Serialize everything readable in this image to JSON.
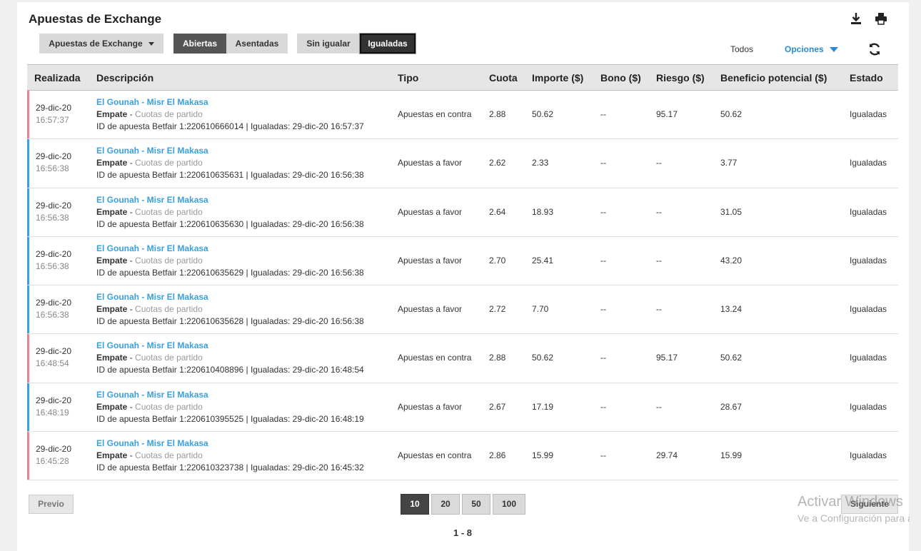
{
  "header": {
    "title": "Apuestas de Exchange",
    "download_icon": "download-icon",
    "print_icon": "print-icon"
  },
  "toolbar": {
    "dropdown_label": "Apuestas de Exchange",
    "tab_open": "Abiertas",
    "tab_settled": "Asentadas",
    "filter_unmatched": "Sin igualar",
    "filter_matched": "Igualadas",
    "todos": "Todos",
    "options": "Opciones",
    "refresh_icon": "refresh-icon"
  },
  "columns": [
    "Realizada",
    "Descripción",
    "Tipo",
    "Cuota",
    "Importe ($)",
    "Bono ($)",
    "Riesgo ($)",
    "Beneficio potencial ($)",
    "Estado"
  ],
  "colors": {
    "lay": "#e8848f",
    "back": "#3aa0e6",
    "link": "#3aa0dd"
  },
  "rows": [
    {
      "side": "lay",
      "date": "29-dic-20",
      "time": "16:57:37",
      "event": "El Gounah - Misr El Makasa",
      "selection": "Empate",
      "market": "Cuotas de partido",
      "bet_id": "ID de apuesta Betfair 1:220610666014 | Igualadas: 29-dic-20 16:57:37",
      "type": "Apuestas en contra",
      "odds": "2.88",
      "stake": "50.62",
      "bonus": "--",
      "risk": "95.17",
      "profit": "50.62",
      "status": "Igualadas"
    },
    {
      "side": "back",
      "date": "29-dic-20",
      "time": "16:56:38",
      "event": "El Gounah - Misr El Makasa",
      "selection": "Empate",
      "market": "Cuotas de partido",
      "bet_id": "ID de apuesta Betfair 1:220610635631 | Igualadas: 29-dic-20 16:56:38",
      "type": "Apuestas a favor",
      "odds": "2.62",
      "stake": "2.33",
      "bonus": "--",
      "risk": "--",
      "profit": "3.77",
      "status": "Igualadas"
    },
    {
      "side": "back",
      "date": "29-dic-20",
      "time": "16:56:38",
      "event": "El Gounah - Misr El Makasa",
      "selection": "Empate",
      "market": "Cuotas de partido",
      "bet_id": "ID de apuesta Betfair 1:220610635630 | Igualadas: 29-dic-20 16:56:38",
      "type": "Apuestas a favor",
      "odds": "2.64",
      "stake": "18.93",
      "bonus": "--",
      "risk": "--",
      "profit": "31.05",
      "status": "Igualadas"
    },
    {
      "side": "back",
      "date": "29-dic-20",
      "time": "16:56:38",
      "event": "El Gounah - Misr El Makasa",
      "selection": "Empate",
      "market": "Cuotas de partido",
      "bet_id": "ID de apuesta Betfair 1:220610635629 | Igualadas: 29-dic-20 16:56:38",
      "type": "Apuestas a favor",
      "odds": "2.70",
      "stake": "25.41",
      "bonus": "--",
      "risk": "--",
      "profit": "43.20",
      "status": "Igualadas"
    },
    {
      "side": "back",
      "date": "29-dic-20",
      "time": "16:56:38",
      "event": "El Gounah - Misr El Makasa",
      "selection": "Empate",
      "market": "Cuotas de partido",
      "bet_id": "ID de apuesta Betfair 1:220610635628 | Igualadas: 29-dic-20 16:56:38",
      "type": "Apuestas a favor",
      "odds": "2.72",
      "stake": "7.70",
      "bonus": "--",
      "risk": "--",
      "profit": "13.24",
      "status": "Igualadas"
    },
    {
      "side": "lay",
      "date": "29-dic-20",
      "time": "16:48:54",
      "event": "El Gounah - Misr El Makasa",
      "selection": "Empate",
      "market": "Cuotas de partido",
      "bet_id": "ID de apuesta Betfair 1:220610408896 | Igualadas: 29-dic-20 16:48:54",
      "type": "Apuestas en contra",
      "odds": "2.88",
      "stake": "50.62",
      "bonus": "--",
      "risk": "95.17",
      "profit": "50.62",
      "status": "Igualadas"
    },
    {
      "side": "back",
      "date": "29-dic-20",
      "time": "16:48:19",
      "event": "El Gounah - Misr El Makasa",
      "selection": "Empate",
      "market": "Cuotas de partido",
      "bet_id": "ID de apuesta Betfair 1:220610395525 | Igualadas: 29-dic-20 16:48:19",
      "type": "Apuestas a favor",
      "odds": "2.67",
      "stake": "17.19",
      "bonus": "--",
      "risk": "--",
      "profit": "28.67",
      "status": "Igualadas"
    },
    {
      "side": "lay",
      "date": "29-dic-20",
      "time": "16:45:28",
      "event": "El Gounah - Misr El Makasa",
      "selection": "Empate",
      "market": "Cuotas de partido",
      "bet_id": "ID de apuesta Betfair 1:220610323738 | Igualadas: 29-dic-20 16:45:32",
      "type": "Apuestas en contra",
      "odds": "2.86",
      "stake": "15.99",
      "bonus": "--",
      "risk": "29.74",
      "profit": "15.99",
      "status": "Igualadas"
    }
  ],
  "pagination": {
    "prev": "Previo",
    "next": "Siguiente",
    "sizes": [
      "10",
      "20",
      "50",
      "100"
    ],
    "active_size": "10",
    "range": "1 - 8"
  },
  "watermark": {
    "line1": "Activar Windows",
    "line2": "Ve a Configuración para a"
  }
}
